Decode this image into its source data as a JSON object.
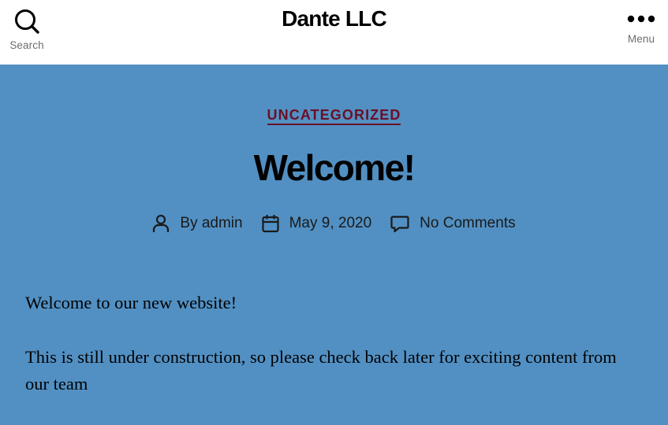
{
  "header": {
    "site_title": "Dante LLC",
    "search_label": "Search",
    "search_icon": "search-icon",
    "menu_label": "Menu",
    "menu_icon": "ellipsis-icon"
  },
  "post": {
    "category": "UNCATEGORIZED",
    "title": "Welcome!",
    "meta": {
      "author": "By admin",
      "date": "May 9, 2020",
      "comments": "No Comments"
    },
    "paragraphs": [
      "Welcome to our new website!",
      "This is still under construction, so please check back later for exciting content from our team"
    ]
  },
  "colors": {
    "background": "#5290c3",
    "header_background": "#ffffff",
    "accent": "#6b0f26"
  }
}
